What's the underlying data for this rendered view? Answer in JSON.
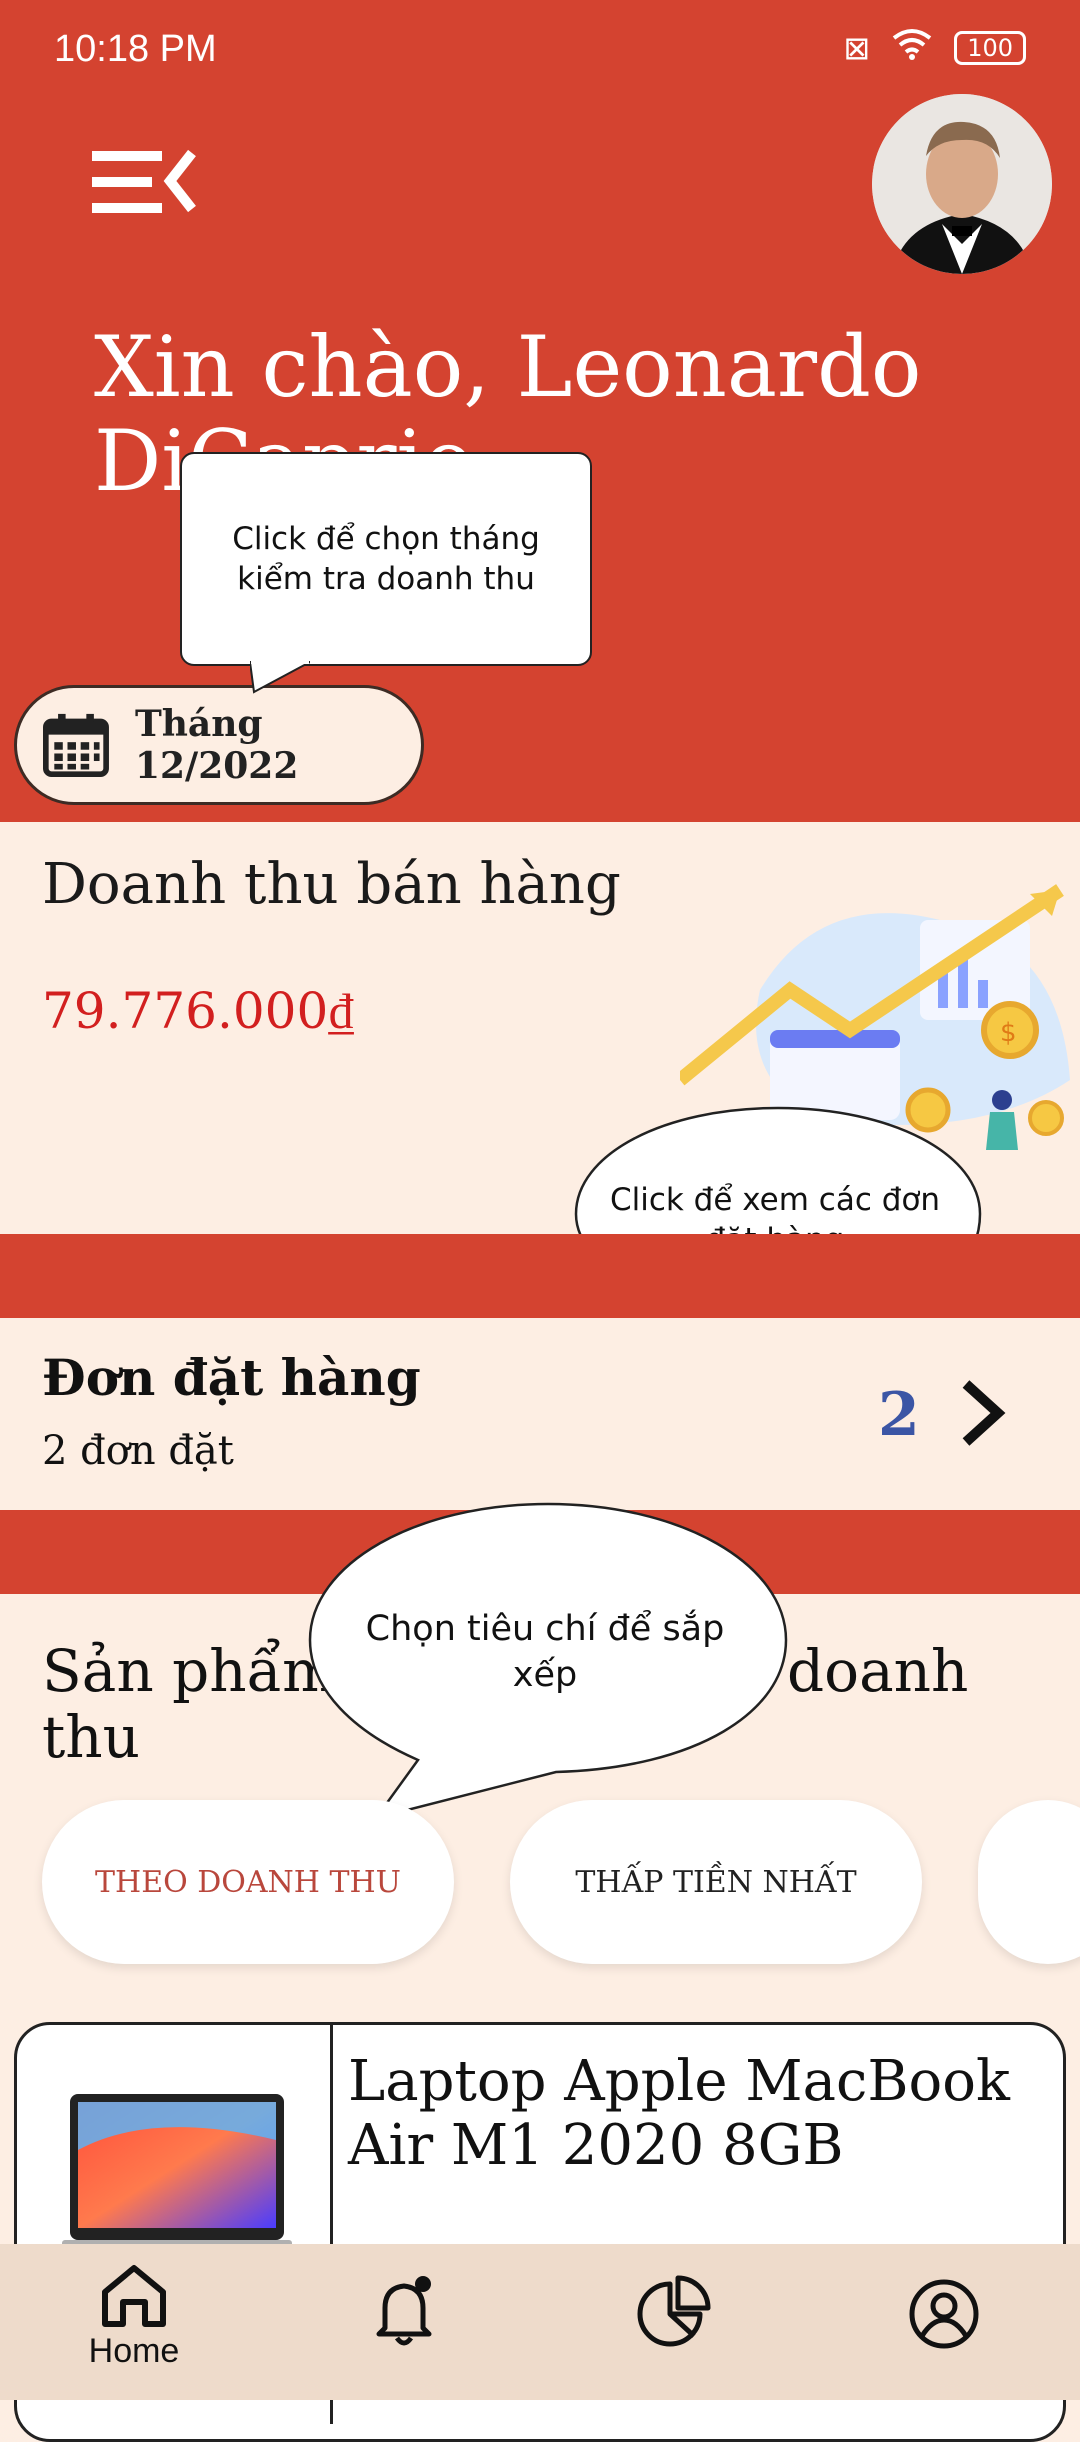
{
  "status_bar": {
    "time": "10:18 PM",
    "battery": "100"
  },
  "header": {
    "greeting": "Xin chào, Leonardo DiCaprio",
    "month_label": "Tháng 12/2022"
  },
  "tooltips": {
    "month_tip": "Click để chọn tháng kiểm tra doanh thu",
    "orders_tip": "Click để xem các đơn đặt hàng",
    "sort_tip": "Chọn tiêu chí để sắp xếp"
  },
  "revenue": {
    "title": "Doanh thu bán hàng",
    "value": "79.776.000₫"
  },
  "orders": {
    "title": "Đơn đặt hàng",
    "subtitle": "2 đơn đặt",
    "count": "2"
  },
  "products": {
    "title": "Sản phẩm bán chạy theo doanh thu",
    "sort_chips": [
      "THEO DOANH THU",
      "THẤP TIỀN NHẤT"
    ],
    "items": [
      {
        "name": "Laptop Apple MacBook Air M1 2020 8GB"
      }
    ]
  },
  "bottom_nav": {
    "home_label": "Home"
  },
  "colors": {
    "primary": "#d44330",
    "background": "#fdeee3",
    "price": "#d21f1f",
    "count": "#3b55a5"
  }
}
